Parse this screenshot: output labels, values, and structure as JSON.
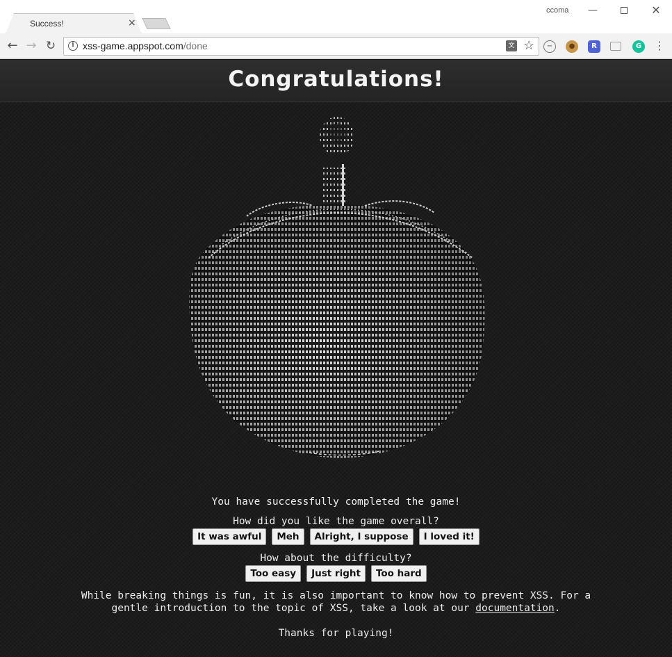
{
  "browser": {
    "tab_title": "Success!",
    "tab_close": "×",
    "profile_name": "ccoma",
    "url_host": "xss-game.appspot.com",
    "url_path": "/done",
    "window_controls": {
      "minimize": "—",
      "maximize": "",
      "close": "✕"
    },
    "icons": {
      "back": "back-arrow-icon",
      "forward": "forward-arrow-icon",
      "reload": "reload-icon",
      "info": "info-icon",
      "translate": "translate-icon",
      "star": "star-icon",
      "menu": "kebab-menu-icon"
    },
    "extension_letters": {
      "blocker": "−",
      "cookie": "●",
      "r": "R",
      "g": "G"
    }
  },
  "page": {
    "banner_title": "Congratulations!",
    "art_description_icon": "ascii-cake-icon",
    "complete_message": "You have successfully completed the game!",
    "question_overall": "How did you like the game overall?",
    "overall_options": [
      "It was awful",
      "Meh",
      "Alright, I suppose",
      "I loved it!"
    ],
    "question_difficulty": "How about the difficulty?",
    "difficulty_options": [
      "Too easy",
      "Just right",
      "Too hard"
    ],
    "info_line1": "While breaking things is fun, it is also important to know how to prevent XSS. For a",
    "info_line2_pre": "gentle introduction to the topic of XSS, take a look at our ",
    "info_link": "documentation",
    "info_line2_post": ".",
    "thanks": "Thanks for playing!"
  },
  "colors": {
    "page_background": "#1c1c1c",
    "banner_background": "#2a2a2a",
    "text": "#ededed",
    "ascii_art": "#d9d9d9",
    "accent_extension_grammarly": "#15c39a",
    "accent_extension_r": "#5063d6"
  }
}
